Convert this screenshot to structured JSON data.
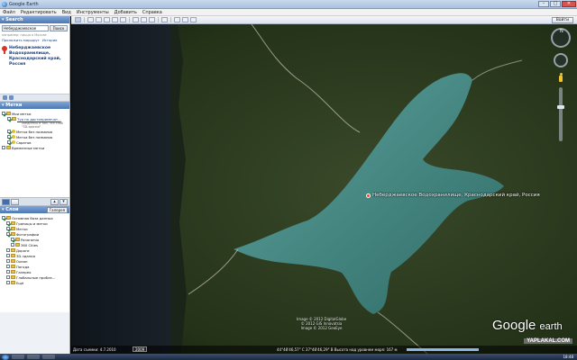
{
  "window": {
    "title": "Google Earth",
    "minimize": "–",
    "maximize": "□",
    "close": "✕"
  },
  "menu": [
    "Файл",
    "Редактировать",
    "Вид",
    "Инструменты",
    "Добавить",
    "Справка"
  ],
  "search": {
    "panel_title": "▾ Search",
    "query": "Неберджаевское",
    "button": "Поиск",
    "hint": "например: пицца в Москве",
    "link_route": "Проложить маршрут",
    "link_history": "История",
    "result": "Неберджаевское Водохранилище, Краснодарский край, Россия"
  },
  "places": {
    "panel_title": "▾ Метки",
    "items": [
      {
        "label": "Мои метки",
        "checked": true
      },
      {
        "label": "Тур по достопримечат...",
        "checked": true,
        "link": true
      },
      {
        "label": "Метка без названия",
        "checked": true
      },
      {
        "label": "Метка без названия",
        "checked": true
      },
      {
        "label": "Саратов",
        "checked": true
      },
      {
        "label": "Временные метки",
        "checked": false
      }
    ],
    "tour_note": "Убедитесь в том, что слой \"3D-здания\""
  },
  "layers": {
    "panel_title": "▾ Слои",
    "gallery_button": "Галерея",
    "items": [
      {
        "label": "Основная база данных",
        "checked": true
      },
      {
        "label": "Границы и метки",
        "checked": true
      },
      {
        "label": "Метки",
        "checked": true
      },
      {
        "label": "Фотографии",
        "checked": true
      },
      {
        "label": "Panoramio",
        "checked": true
      },
      {
        "label": "360 Cities",
        "checked": false
      },
      {
        "label": "Дороги",
        "checked": false
      },
      {
        "label": "3D-здания",
        "checked": false
      },
      {
        "label": "Океан",
        "checked": false
      },
      {
        "label": "Погода",
        "checked": false
      },
      {
        "label": "Галерея",
        "checked": false
      },
      {
        "label": "Глобальные пробле...",
        "checked": false
      },
      {
        "label": "Ещё",
        "checked": false
      }
    ]
  },
  "toolbar": {
    "signin": "Войти"
  },
  "map": {
    "place_label": "Неберджаевское Водохранилище, Краснодарский край, Россия",
    "copyright": [
      "Image © 2012 DigitalGlobe",
      "© 2012 GIS Innovatsia",
      "Image © 2012 GeoEye"
    ],
    "brand_google": "Google",
    "brand_earth": "earth",
    "compass_n": "N",
    "imagery_date": "Дата съемки: 4.7.2010",
    "year_button": "2009",
    "coords": "44°48'46,57\" С  37°48'46,29\" В  Высота над уровнем моря:  167 м",
    "watermark": "YAPLAKAL.COM"
  },
  "taskbar": {
    "clock": "18:48"
  }
}
